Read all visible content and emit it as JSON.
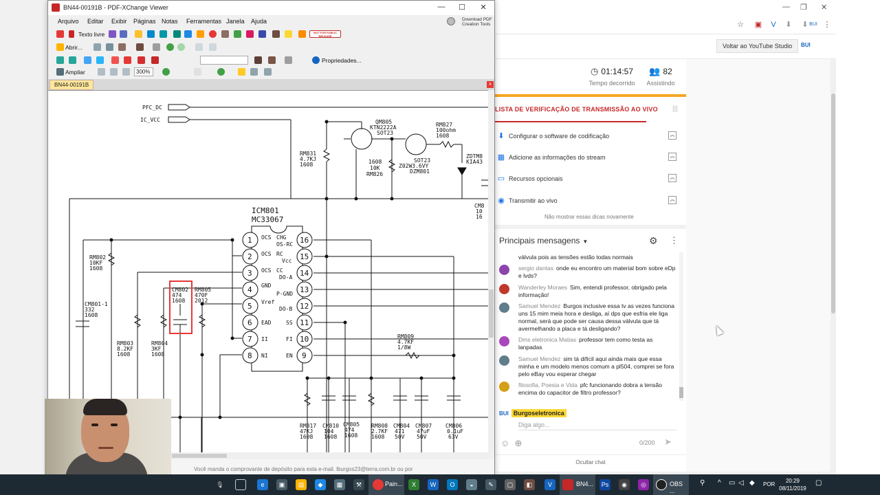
{
  "browser": {
    "yt_studio_button": "Voltar ao YouTube Studio",
    "brand_small": "BUI"
  },
  "stats": {
    "elapsed_value": "01:14:57",
    "elapsed_label": "Tempo decorrido",
    "watching_value": "82",
    "watching_label": "Assistindo"
  },
  "checklist": {
    "title": "LISTA DE VERIFICAÇÃO DE TRANSMISSÃO AO VIVO",
    "items": [
      {
        "label": "Configurar o software de codificação",
        "icon": "download-icon"
      },
      {
        "label": "Adicione as informações do stream",
        "icon": "chart-icon"
      },
      {
        "label": "Recursos opcionais",
        "icon": "window-icon"
      },
      {
        "label": "Transmitir ao vivo",
        "icon": "broadcast-icon"
      }
    ],
    "note": "Não mostrar essas dicas novamente"
  },
  "chat": {
    "header": "Principais mensagens",
    "messages": [
      {
        "author": "",
        "text": "válvula pois as tensões estão todas normais",
        "color": "#ffffff"
      },
      {
        "author": "sergio dantas",
        "text": "onde eu encontro um material bom sobre eDp e lvds?",
        "color": "#8e44ad"
      },
      {
        "author": "Wanderley Moraes",
        "text": "Sim, entendi professor, obrigado pela informação!",
        "color": "#c0392b"
      },
      {
        "author": "Samuel Mendez",
        "text": "Burgos inclusive essa tv as vezes funciona uns 15 mim meia hora e desliga, aí dps que esfria ele liga normal, será que pode ser causa dessa válvula que tá avermelhando a placa e tá desligando?",
        "color": "#607d8b"
      },
      {
        "author": "Dms eletronica Matias",
        "text": "professor tem como testa as lanpadas",
        "color": "#ab47bc"
      },
      {
        "author": "Samuel Mendez",
        "text": "sim tá difícil aqui ainda mais que essa minha e um modelo menos comum a pl504, comprei se fora pelo eBay vou esperar chegar",
        "color": "#607d8b"
      },
      {
        "author": "filosofia, Poesia e Vida",
        "text": "pfc funcionando dobra a tensão encima do capacitor de filtro professor?",
        "color": "#d4a017"
      }
    ],
    "user_badge": "Burgoseletronica",
    "user_logo": "BUI",
    "input_placeholder": "Diga algo...",
    "char_count": "0/200",
    "hide": "Ocultar chat"
  },
  "pdf": {
    "window_title": "BN44-00191B - PDF-XChange Viewer",
    "menu": [
      "Arquivo",
      "Editar",
      "Exibir",
      "Páginas",
      "Notas",
      "Ferramentas",
      "Janela",
      "Ajuda"
    ],
    "download_line1": "Download PDF",
    "download_line2": "Creation Tools",
    "toolbar": {
      "texto_livre": "Texto livre",
      "abrir": "Abrir...",
      "propriedades": "Propriedades...",
      "ampliar": "Ampliar",
      "zoom": "300%",
      "stamp": "NOT FOR PUBLIC RELEASE"
    },
    "tab": "BN44-00191B",
    "status_text": "Você manda o comprovante de depósito para esta e-mail. lburgos23@terra.com.br ou por"
  },
  "schematic": {
    "labels": {
      "pfc_dc": "PFC_DC",
      "ic_vcc": "IC_VCC",
      "icm801": "ICM801",
      "mc33067": "MC33067",
      "qm805": "QM805",
      "ktn": "KTN2222A",
      "sot23a": "SOT23",
      "rm827": "RM827",
      "rm827v": "100ohm",
      "rm827p": "1608",
      "zdtm": "ZDTM8",
      "kia": "KIA43",
      "rm831": "RM831",
      "rm831v": "4.7KJ",
      "rm831p": "1608",
      "rm826p": "1608",
      "rm826v": "10K",
      "rm826": "RM826",
      "sot23b": "SOT23",
      "z02": "Z02W3.6VY",
      "dzm": "DZM801",
      "cm8": "CM8",
      "cm8a": "10",
      "cm8b": "16",
      "rm802": "RM802",
      "rm802v": "10KF",
      "rm802p": "1608",
      "cm801": "CM801-1",
      "cm801v": "332",
      "cm801p": "1608",
      "cm802": "CM802",
      "cm802v": "474",
      "cm802p": "1608",
      "rm805": "RM805",
      "rm805v": "470F",
      "rm805p": "2012",
      "rm803": "RM803",
      "rm803v": "8.2KF",
      "rm803p": "1608",
      "rm804": "RM804",
      "rm804v": "3KF",
      "rm804p": "1608",
      "rm809": "RM809",
      "rm809v": "4.7KF",
      "rm809p": "1/8W",
      "rm817": "RM817",
      "rm817v": "47KJ",
      "rm817p": "1608",
      "cm810": "CM810",
      "cm810v": "104",
      "cm810p": "1608",
      "cm805": "CM805",
      "cm805v": "474",
      "cm805p": "1608",
      "rm808": "RM808",
      "rm808v": "2.7KF",
      "rm808p": "1608",
      "cm804": "CM804",
      "cm804v": "471",
      "cm804p": "50V",
      "cm807": "CM807",
      "cm807v": "47uF",
      "cm807p": "50V",
      "cm806": "CM806",
      "cm806v": "0.1uF",
      "cm806p": "63V"
    },
    "left_pins": [
      {
        "num": "1",
        "name": "OCS"
      },
      {
        "num": "2",
        "name": "OCS"
      },
      {
        "num": "3",
        "name": "OCS"
      },
      {
        "num": "4",
        "name": "GND"
      },
      {
        "num": "5",
        "name": "Vref"
      },
      {
        "num": "6",
        "name": "EAD"
      },
      {
        "num": "7",
        "name": "II"
      },
      {
        "num": "8",
        "name": "NI"
      }
    ],
    "right_pins": [
      {
        "num": "16",
        "name": "CHG",
        "name2": "OS-RC"
      },
      {
        "num": "15",
        "name": "RC",
        "name2": "Vcc"
      },
      {
        "num": "14",
        "name": "CC",
        "name2": "DO-A"
      },
      {
        "num": "13",
        "name": "P-GND",
        "name2": ""
      },
      {
        "num": "12",
        "name": "DO-B",
        "name2": ""
      },
      {
        "num": "11",
        "name": "SS",
        "name2": ""
      },
      {
        "num": "10",
        "name": "FI",
        "name2": ""
      },
      {
        "num": "9",
        "name": "EN",
        "name2": ""
      }
    ]
  },
  "taskbar": {
    "paint_label": "Pain...",
    "bn_label": "BN4...",
    "obs_label": "OBS ...",
    "lang": "POR",
    "time": "20:29",
    "date": "08/11/2019"
  }
}
